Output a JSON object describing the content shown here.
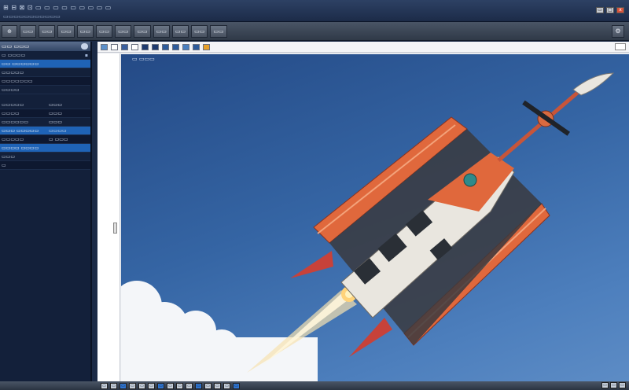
{
  "window": {
    "title": "⊞ ⊟ ⊠ ⊡ ▭ ▭ ▭ ▭ ▭ ▭ ▭ ▭ ▭",
    "subtitle": "▭▭▭▭▭▭▭▭▭▭▭",
    "buttons": [
      "▭",
      "□",
      "x"
    ]
  },
  "toolbar": {
    "buttons": [
      "⊕",
      "▭▭",
      "▭▭",
      "▭▭",
      "▭▭",
      "▭▭",
      "▭▭",
      "▭▭",
      "▭▭",
      "▭▭",
      "▭▭",
      "▭▭"
    ],
    "right_button": "⚙"
  },
  "sidebar": {
    "header": "▭▭ ▭▭▭",
    "rows": [
      {
        "label": "▭ ▭▭▭▭",
        "value": "",
        "flag": "▪",
        "state": "normal"
      },
      {
        "label": "▭▭ ▭▭▭▭▭▭",
        "value": "",
        "flag": "",
        "state": "sel"
      },
      {
        "label": "▭▭▭▭▭",
        "value": "",
        "flag": "",
        "state": "normal"
      },
      {
        "label": "▭▭▭▭▭▭▭",
        "value": "",
        "flag": "",
        "state": "dark"
      },
      {
        "label": "▭▭▭▭",
        "value": "",
        "flag": "",
        "state": "normal"
      },
      {
        "label": "▭▭▭▭▭",
        "value": "▭▭▭",
        "flag": "",
        "state": "normal"
      },
      {
        "label": "▭▭▭▭",
        "value": "▭▭▭",
        "flag": "",
        "state": "dark"
      },
      {
        "label": "▭▭▭▭▭▭",
        "value": "▭▭▭",
        "flag": "",
        "state": "normal"
      },
      {
        "label": "▭▭▭ ▭▭▭▭▭",
        "value": "▭▭▭▭",
        "flag": "",
        "state": "sel"
      },
      {
        "label": "▭▭▭▭▭",
        "value": "▭ ▭▭▭",
        "flag": "",
        "state": "dark"
      },
      {
        "label": "▭▭▭▭ ▭▭▭▭",
        "value": "",
        "flag": "",
        "state": "sel"
      },
      {
        "label": "▭▭▭",
        "value": "",
        "flag": "",
        "state": "normal"
      },
      {
        "label": "▭",
        "value": "",
        "flag": "",
        "state": "dark"
      }
    ]
  },
  "viewer": {
    "file_label": "▭ ▭▭▭",
    "swatches": [
      "#5b8fc9",
      "#ffffff",
      "#3a5f9e",
      "#ffffff",
      "#1e3a6e",
      "#1e3a6e",
      "#2d5b9a",
      "#2d5b9a",
      "#4a7fbe",
      "#2d5b9a",
      "#e7a12a"
    ],
    "image": {
      "subject": "orange-white-aircraft-with-rocket-exhaust",
      "colors": {
        "hull": "#e0683c",
        "cabin": "#e9e6df",
        "exhaust": "#f7e3b0",
        "cloud": "#f4f6f9"
      }
    }
  },
  "statusbar": {
    "buttons": [
      "▭",
      "▭",
      "▭",
      "▭",
      "▭",
      "▭",
      "▭",
      "▭",
      "▭",
      "▭",
      "▭",
      "▭",
      "▭",
      "▭",
      "▭"
    ],
    "right": [
      "▭",
      "▭",
      "▭"
    ]
  }
}
